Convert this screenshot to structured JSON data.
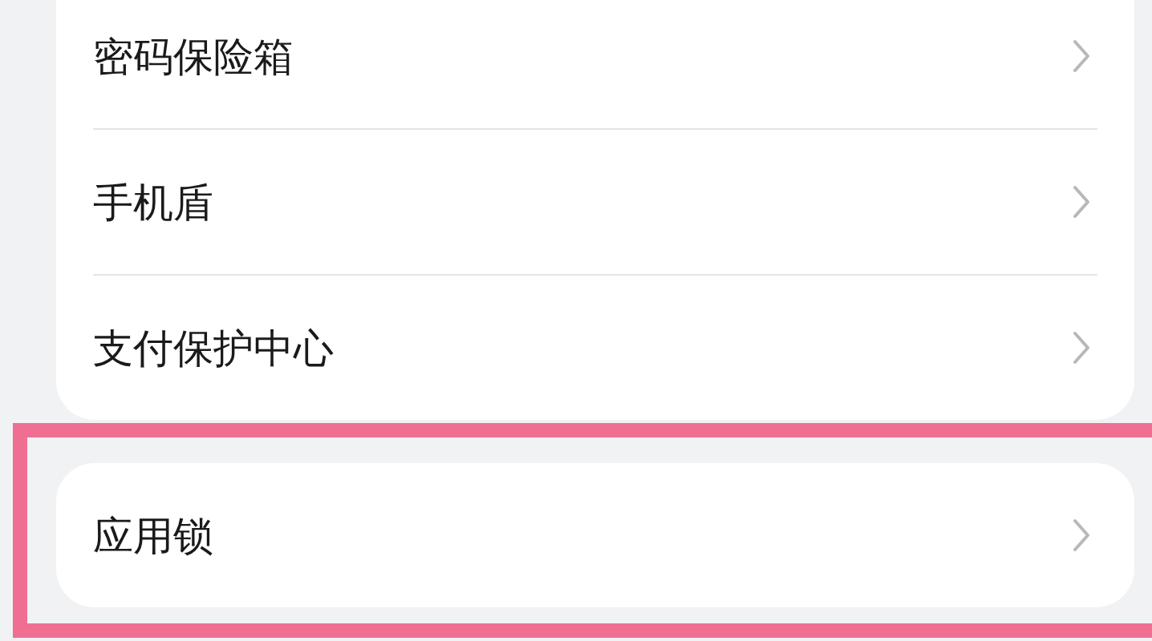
{
  "groups": [
    {
      "highlighted": false,
      "items": [
        {
          "label": "密码保险箱"
        },
        {
          "label": "手机盾"
        },
        {
          "label": "支付保护中心"
        }
      ]
    },
    {
      "highlighted": true,
      "items": [
        {
          "label": "应用锁"
        }
      ]
    }
  ]
}
